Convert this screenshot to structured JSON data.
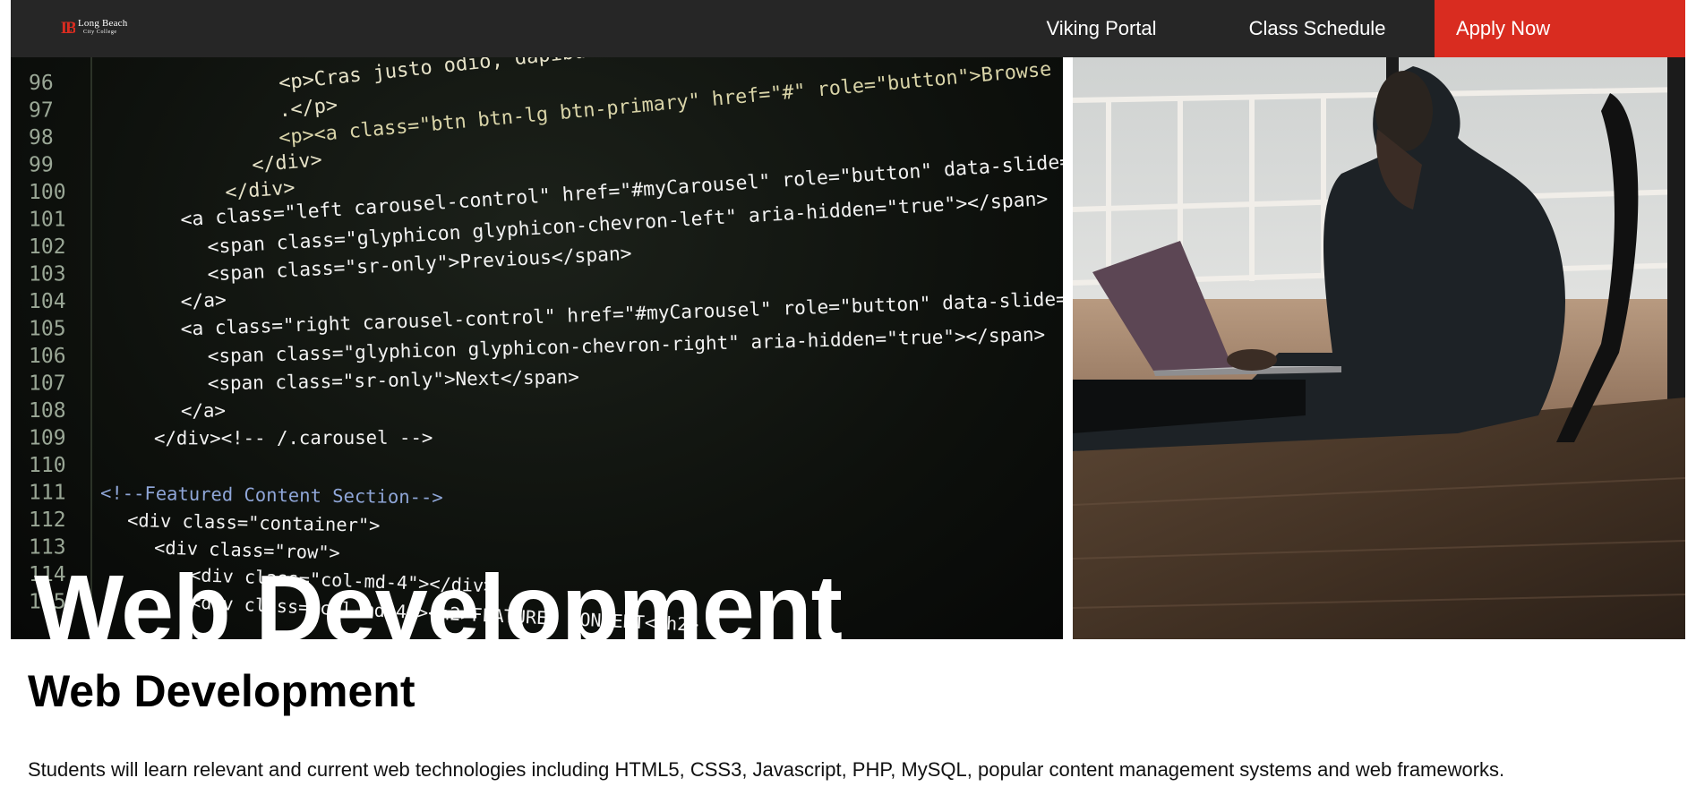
{
  "header": {
    "logo": {
      "line1": "Long Beach",
      "line2": "City College",
      "accent_color": "#d92c20"
    },
    "nav": [
      {
        "label": "Viking Portal"
      },
      {
        "label": "Class Schedule"
      },
      {
        "label": "Apply Now",
        "color": "#d92c20"
      }
    ]
  },
  "hero": {
    "title": "Web Development",
    "code_lines": [
      {
        "num": "96",
        "code": "<p>Cras justo odio, dapibus ac facilisis in,"
      },
      {
        "num": "97",
        "code": ".</p>"
      },
      {
        "num": "98",
        "code": "<p><a class=\"btn btn-lg btn-primary\" href=\"#\" role=\"button\">Browse gallery</a>"
      },
      {
        "num": "99",
        "code": "</div>"
      },
      {
        "num": "100",
        "code": "</div>"
      },
      {
        "num": "101",
        "code": "<a class=\"left carousel-control\" href=\"#myCarousel\" role=\"button\" data-slide=\"prev\">"
      },
      {
        "num": "102",
        "code": "<span class=\"glyphicon glyphicon-chevron-left\" aria-hidden=\"true\"></span>"
      },
      {
        "num": "103",
        "code": "<span class=\"sr-only\">Previous</span>"
      },
      {
        "num": "104",
        "code": "</a>"
      },
      {
        "num": "105",
        "code": "<a class=\"right carousel-control\" href=\"#myCarousel\" role=\"button\" data-slide=\"next\">"
      },
      {
        "num": "106",
        "code": "<span class=\"glyphicon glyphicon-chevron-right\" aria-hidden=\"true\"></span>"
      },
      {
        "num": "107",
        "code": "<span class=\"sr-only\">Next</span>"
      },
      {
        "num": "108",
        "code": "</a>"
      },
      {
        "num": "109",
        "code": "</div><!-- /.carousel -->"
      },
      {
        "num": "110",
        "code": ""
      },
      {
        "num": "111",
        "code": "<!--Featured Content Section-->"
      },
      {
        "num": "112",
        "code": "<div class=\"container\">"
      },
      {
        "num": "113",
        "code": "<div class=\"row\">"
      },
      {
        "num": "114",
        "code": "<div class=\"col-md-4\"></div>"
      },
      {
        "num": "115",
        "code": "<div class=\"col-md-4\"><h2>FEATURED CONTENT</h2>"
      }
    ]
  },
  "content": {
    "title": "Web Development",
    "body": "Students will learn relevant and current web technologies including HTML5, CSS3, Javascript, PHP, MySQL, popular content management systems and web frameworks."
  }
}
